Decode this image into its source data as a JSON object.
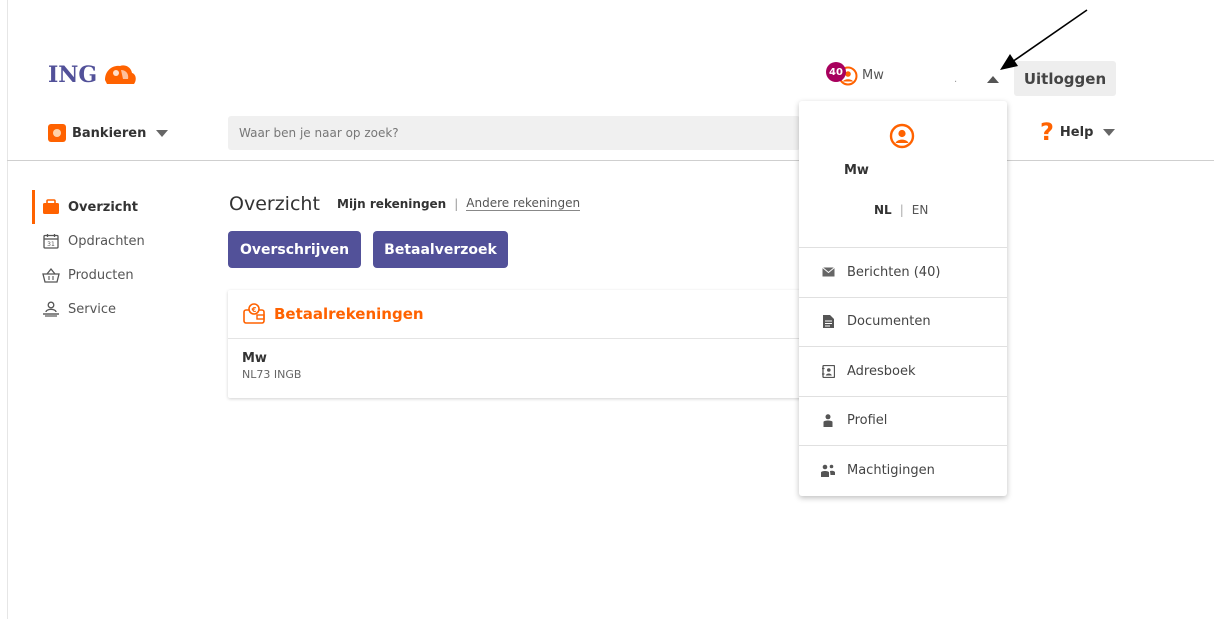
{
  "header": {
    "logo_text": "ING",
    "badge_count": "40",
    "user_name": "Mw",
    "separator_dot": ".",
    "logout_label": "Uitloggen"
  },
  "nav": {
    "bank_label": "Bankieren",
    "search_placeholder": "Waar ben je naar op zoek?",
    "help_label": "Help"
  },
  "sidebar": {
    "items": [
      {
        "label": "Overzicht",
        "icon": "wallet-icon",
        "active": true
      },
      {
        "label": "Opdrachten",
        "icon": "calendar-icon",
        "active": false
      },
      {
        "label": "Producten",
        "icon": "basket-icon",
        "active": false
      },
      {
        "label": "Service",
        "icon": "person-desk-icon",
        "active": false
      }
    ]
  },
  "main": {
    "title": "Overzicht",
    "tab_active": "Mijn rekeningen",
    "tab_separator": "|",
    "tab_other": "Andere rekeningen",
    "btn_transfer": "Overschrijven",
    "btn_request": "Betaalverzoek",
    "card": {
      "title": "Betaalrekeningen",
      "account_name": "Mw",
      "account_iban": "NL73 INGB"
    }
  },
  "dropdown": {
    "user_name": "Mw",
    "lang_nl": "NL",
    "lang_separator": "|",
    "lang_en": "EN",
    "items": [
      {
        "label": "Berichten (40)",
        "icon": "envelope-icon"
      },
      {
        "label": "Documenten",
        "icon": "document-icon"
      },
      {
        "label": "Adresboek",
        "icon": "address-book-icon"
      },
      {
        "label": "Profiel",
        "icon": "person-icon"
      },
      {
        "label": "Machtigingen",
        "icon": "people-icon"
      }
    ]
  },
  "colors": {
    "brand_orange": "#ff6200",
    "brand_indigo": "#525199",
    "badge": "#a8005d"
  }
}
